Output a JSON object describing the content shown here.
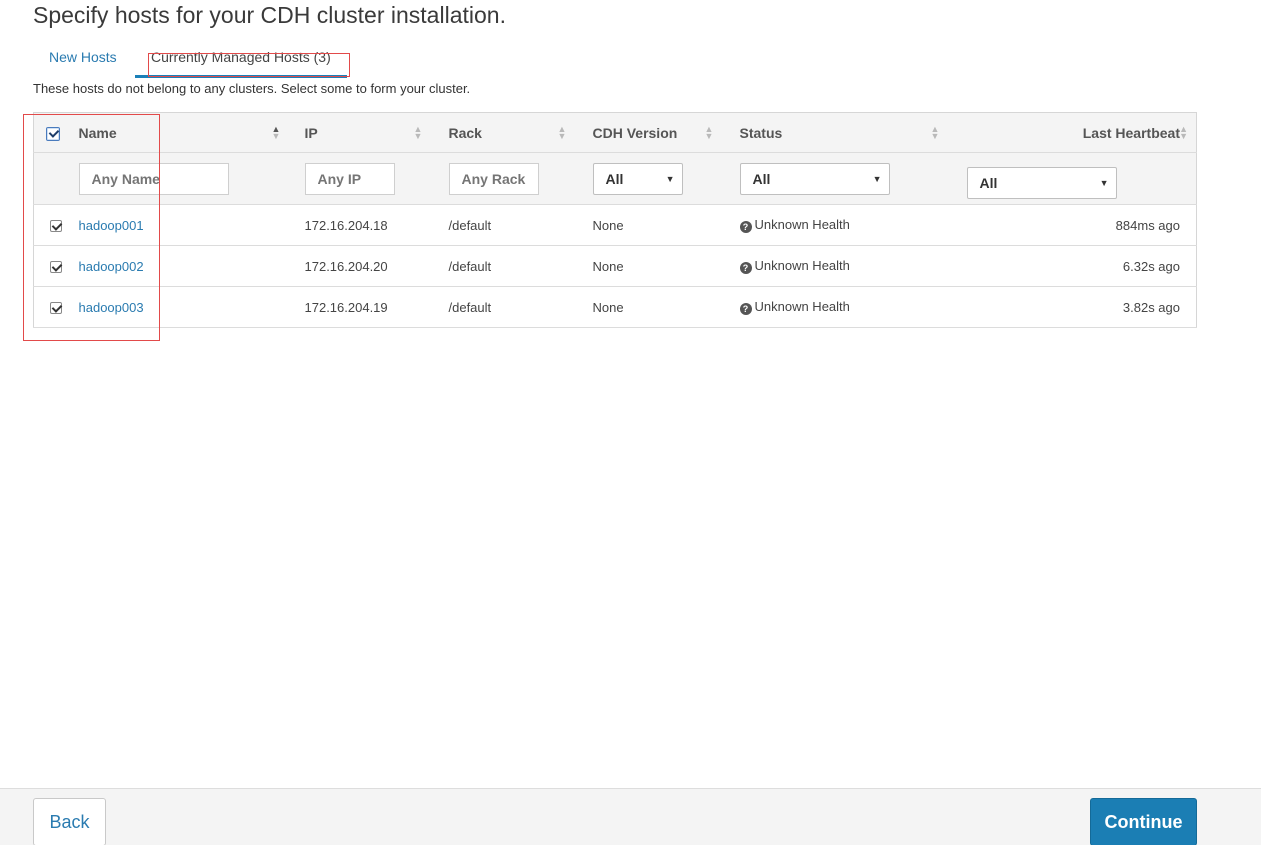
{
  "page": {
    "title": "Specify hosts for your CDH cluster installation.",
    "intro": "These hosts do not belong to any clusters. Select some to form your cluster."
  },
  "tabs": [
    {
      "label": "New Hosts",
      "active": false
    },
    {
      "label": "Currently Managed Hosts (3)",
      "active": true
    }
  ],
  "table": {
    "select_all_checked": true,
    "columns": {
      "name": "Name",
      "ip": "IP",
      "rack": "Rack",
      "cdh_version": "CDH Version",
      "status": "Status",
      "last_heartbeat": "Last Heartbeat"
    },
    "filters": {
      "name_placeholder": "Any Name",
      "ip_placeholder": "Any IP",
      "rack_placeholder": "Any Rack",
      "cdh_version": "All",
      "status": "All",
      "last_heartbeat": "All"
    },
    "rows": [
      {
        "checked": true,
        "name": "hadoop001",
        "ip": "172.16.204.18",
        "rack": "/default",
        "cdh_version": "None",
        "status": "Unknown Health",
        "last_heartbeat": "884ms ago"
      },
      {
        "checked": true,
        "name": "hadoop002",
        "ip": "172.16.204.20",
        "rack": "/default",
        "cdh_version": "None",
        "status": "Unknown Health",
        "last_heartbeat": "6.32s ago"
      },
      {
        "checked": true,
        "name": "hadoop003",
        "ip": "172.16.204.19",
        "rack": "/default",
        "cdh_version": "None",
        "status": "Unknown Health",
        "last_heartbeat": "3.82s ago"
      }
    ]
  },
  "footer": {
    "back_label": "Back",
    "continue_label": "Continue"
  },
  "colors": {
    "accent": "#1b7eb4",
    "link": "#2a7bb0",
    "highlight_box": "#e24a4a"
  }
}
